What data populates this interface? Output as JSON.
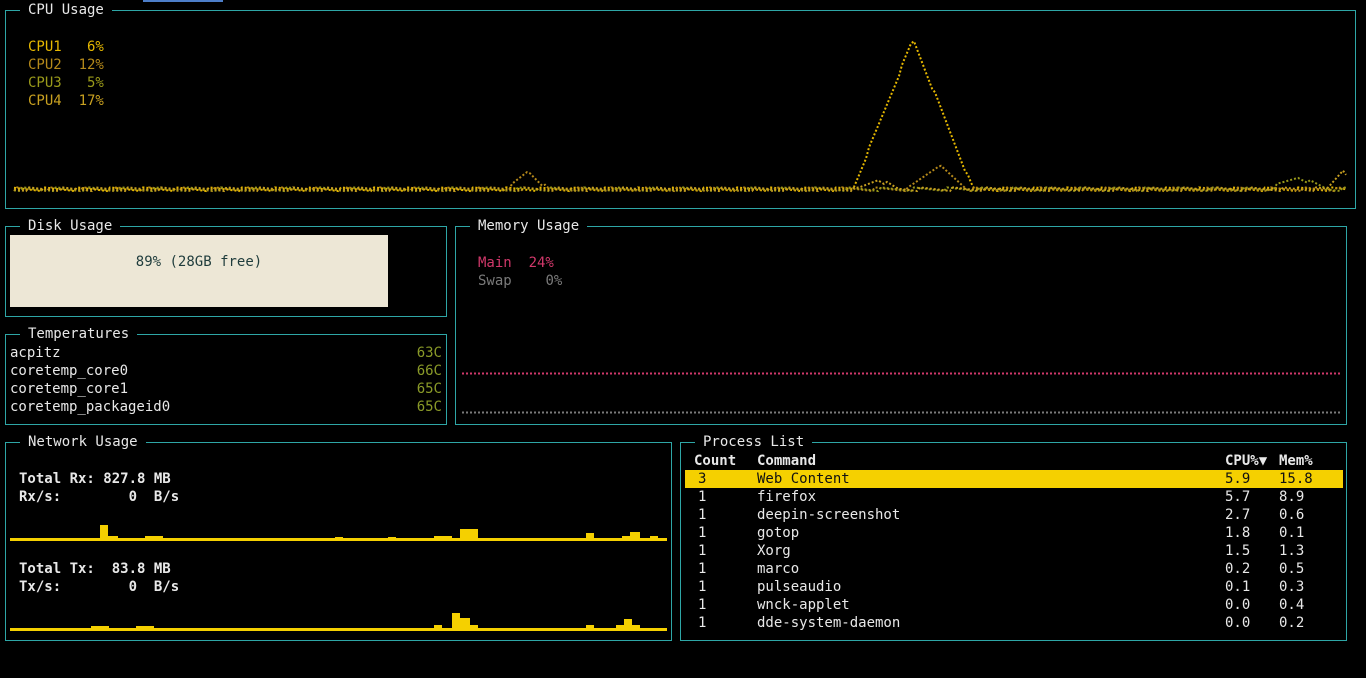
{
  "cpu": {
    "title": "CPU Usage",
    "items": [
      {
        "label": "CPU1",
        "value": " 6%",
        "color": "#e6b800"
      },
      {
        "label": "CPU2",
        "value": "12%",
        "color": "#b5891a"
      },
      {
        "label": "CPU3",
        "value": " 5%",
        "color": "#9a9a1a"
      },
      {
        "label": "CPU4",
        "value": "17%",
        "color": "#c8a020"
      }
    ]
  },
  "disk": {
    "title": "Disk Usage",
    "percent": 89,
    "label": "89% (28GB free)"
  },
  "temps": {
    "title": "Temperatures",
    "rows": [
      {
        "name": "acpitz",
        "value": "63C"
      },
      {
        "name": "coretemp_core0",
        "value": "66C"
      },
      {
        "name": "coretemp_core1",
        "value": "65C"
      },
      {
        "name": "coretemp_packageid0",
        "value": "65C"
      }
    ]
  },
  "memory": {
    "title": "Memory Usage",
    "main_label": "Main",
    "main_value": "24%",
    "swap_label": "Swap",
    "swap_value": " 0%",
    "main_color": "#d0386a",
    "swap_color": "#7a7a7a"
  },
  "network": {
    "title": "Network Usage",
    "rx_total_label": "Total Rx:",
    "rx_total_value": "827.8 MB",
    "rx_rate_label": "Rx/s:",
    "rx_rate_value": "0  B/s",
    "tx_total_label": "Total Tx:",
    "tx_total_value": " 83.8 MB",
    "tx_rate_label": "Tx/s:",
    "tx_rate_value": "0  B/s",
    "color": "#f5d000"
  },
  "process": {
    "title": "Process List",
    "headers": {
      "count": "Count",
      "command": "Command",
      "cpu": "CPU%▼",
      "mem": "Mem%"
    },
    "rows": [
      {
        "count": "3",
        "command": "Web Content",
        "cpu": "5.9",
        "mem": "15.8"
      },
      {
        "count": "1",
        "command": "firefox",
        "cpu": "5.7",
        "mem": "8.9"
      },
      {
        "count": "1",
        "command": "deepin-screenshot",
        "cpu": "2.7",
        "mem": "0.6"
      },
      {
        "count": "1",
        "command": "gotop",
        "cpu": "1.8",
        "mem": "0.1"
      },
      {
        "count": "1",
        "command": "Xorg",
        "cpu": "1.5",
        "mem": "1.3"
      },
      {
        "count": "1",
        "command": "marco",
        "cpu": "0.2",
        "mem": "0.5"
      },
      {
        "count": "1",
        "command": "pulseaudio",
        "cpu": "0.1",
        "mem": "0.3"
      },
      {
        "count": "1",
        "command": "wnck-applet",
        "cpu": "0.0",
        "mem": "0.4"
      },
      {
        "count": "1",
        "command": "dde-system-daemon",
        "cpu": "0.0",
        "mem": "0.2"
      }
    ],
    "selected_index": 0
  }
}
